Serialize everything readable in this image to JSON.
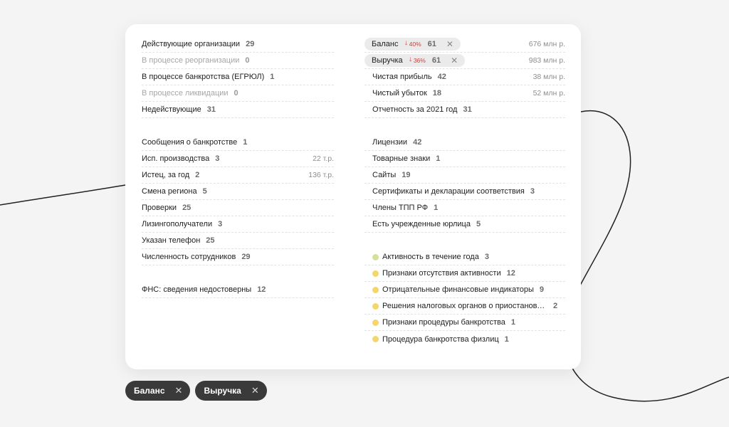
{
  "left_column": {
    "group1": [
      {
        "label": "Действующие организации",
        "count": "29"
      },
      {
        "label": "В процессе реорганизации",
        "count": "0"
      },
      {
        "label": "В процессе банкротства (ЕГРЮЛ)",
        "count": "1"
      },
      {
        "label": "В процессе ликвидации",
        "count": "0"
      },
      {
        "label": "Недействующие",
        "count": "31"
      }
    ],
    "group2": [
      {
        "label": "Сообщения о банкротстве",
        "count": "1"
      },
      {
        "label": "Исп. производства",
        "count": "3",
        "value": "22 т.р."
      },
      {
        "label": "Истец, за год",
        "count": "2",
        "value": "136 т.р."
      },
      {
        "label": "Смена региона",
        "count": "5"
      },
      {
        "label": "Проверки",
        "count": "25"
      },
      {
        "label": "Лизингополучатели",
        "count": "3"
      },
      {
        "label": "Указан телефон",
        "count": "25"
      },
      {
        "label": "Численность сотрудников",
        "count": "29"
      }
    ],
    "group3": [
      {
        "label": "ФНС: сведения недостоверны",
        "count": "12"
      }
    ]
  },
  "right_column": {
    "finance": [
      {
        "label": "Баланс",
        "change": "40%",
        "count": "61",
        "value": "676 млн р."
      },
      {
        "label": "Выручка",
        "change": "36%",
        "count": "61",
        "value": "983 млн р."
      },
      {
        "label": "Чистая прибыль",
        "count": "42",
        "value": "38 млн р."
      },
      {
        "label": "Чистый убыток",
        "count": "18",
        "value": "52 млн р."
      },
      {
        "label": "Отчетность за 2021 год",
        "count": "31"
      }
    ],
    "misc": [
      {
        "label": "Лицензии",
        "count": "42"
      },
      {
        "label": "Товарные знаки",
        "count": "1"
      },
      {
        "label": "Сайты",
        "count": "19"
      },
      {
        "label": "Сертификаты и декларации соответствия",
        "count": "3"
      },
      {
        "label": "Члены ТПП РФ",
        "count": "1"
      },
      {
        "label": "Есть учрежденные юрлица",
        "count": "5"
      }
    ],
    "indicators": [
      {
        "label": "Активность в течение года",
        "count": "3",
        "color": "#d5e09a"
      },
      {
        "label": "Признаки отсутствия активности",
        "count": "12",
        "color": "#f5d66a"
      },
      {
        "label": "Отрицательные финансовые индикаторы",
        "count": "9",
        "color": "#f5d66a"
      },
      {
        "label": "Решения налоговых органов о приостановле...",
        "count": "2",
        "color": "#f5d66a"
      },
      {
        "label": "Признаки процедуры банкротства",
        "count": "1",
        "color": "#f5d66a"
      },
      {
        "label": "Процедура банкротства физлиц",
        "count": "1",
        "color": "#f5d66a"
      }
    ]
  },
  "active_filters": [
    {
      "label": "Баланс",
      "remove": "✕"
    },
    {
      "label": "Выручка",
      "remove": "✕"
    }
  ],
  "icons": {
    "remove": "✕",
    "down_arrow": "🡓"
  },
  "colors": {
    "down": "#c4443b",
    "chip_bg": "#3a3a3a",
    "pill_bg": "#ebebeb"
  }
}
